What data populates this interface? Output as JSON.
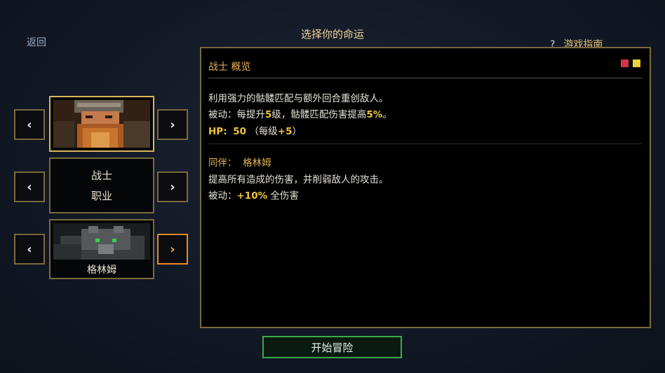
{
  "header": {
    "back_label": "返回",
    "title": "选择你的命运",
    "guide_icon": "?",
    "guide_label": "游戏指南"
  },
  "selectors": {
    "prev_glyph": "‹",
    "next_glyph": "›",
    "class_name": "战士",
    "class_caption": "职业",
    "companion_name": "格林姆"
  },
  "panel": {
    "heading": "战士 概览",
    "dots": [
      "#d8324a",
      "#e8d23a"
    ],
    "class_desc": "利用强力的骷髅匹配与额外回合重创敌人。",
    "passive_prefix": "被动：每提升",
    "passive_level": "5",
    "passive_mid": "级，骷髅匹配伤害提高",
    "passive_pct": "5%",
    "passive_end": "。",
    "hp_label": "HP:",
    "hp_value": "50",
    "hp_open": "（每级",
    "hp_growth": "+5",
    "hp_close": "）",
    "companion_label": "同伴：",
    "companion_name": "格林姆",
    "companion_desc": "提高所有造成的伤害，并削弱敌人的攻击。",
    "companion_passive_prefix": "被动：",
    "companion_passive_value": "+10%",
    "companion_passive_suffix": "全伤害"
  },
  "start_button": "开始冒险"
}
